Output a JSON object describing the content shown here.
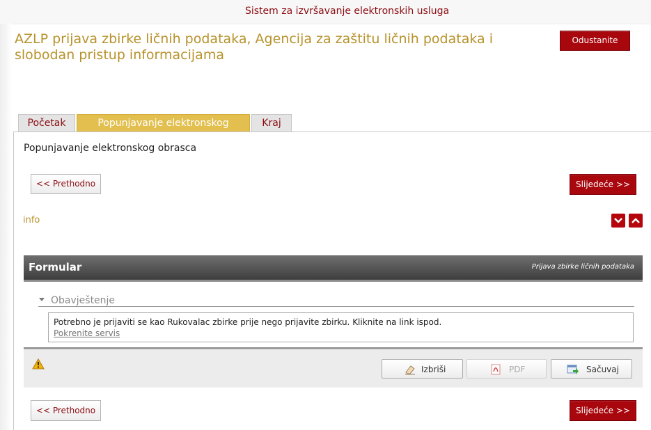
{
  "header": {
    "system_title": "Sistem za izvršavanje elektronskih usluga",
    "page_title": "AZLP prijava zbirke ličnih podataka, Agencija za zaštitu ličnih podataka i slobodan pristup informacijama",
    "cancel_label": "Odustanite"
  },
  "tabs": [
    {
      "label": "Početak",
      "active": false
    },
    {
      "label": "Popunjavanje elektronskog obrasca",
      "active": true
    },
    {
      "label": "Kraj",
      "active": false
    }
  ],
  "section": {
    "heading": "Popunjavanje elektronskog obrasca",
    "prev_label": "<< Prethodno",
    "next_label": "Slijedeće >>",
    "info_label": "info"
  },
  "form": {
    "title": "Formular",
    "subtitle": "Prijava zbirke ličnih podataka",
    "group_label": "Obavještenje",
    "notice_text": "Potrebno je prijaviti se kao Rukovalac zbirke prije nego prijavite zbirku. Kliknite na link ispod.",
    "notice_link": "Pokrenite servis"
  },
  "toolbar": {
    "delete_label": "Izbriši",
    "pdf_label": "PDF",
    "save_label": "Sačuvaj"
  },
  "colors": {
    "brand_red": "#a8070d",
    "title_gold": "#b7922b",
    "tab_active": "#e2bf4e"
  }
}
